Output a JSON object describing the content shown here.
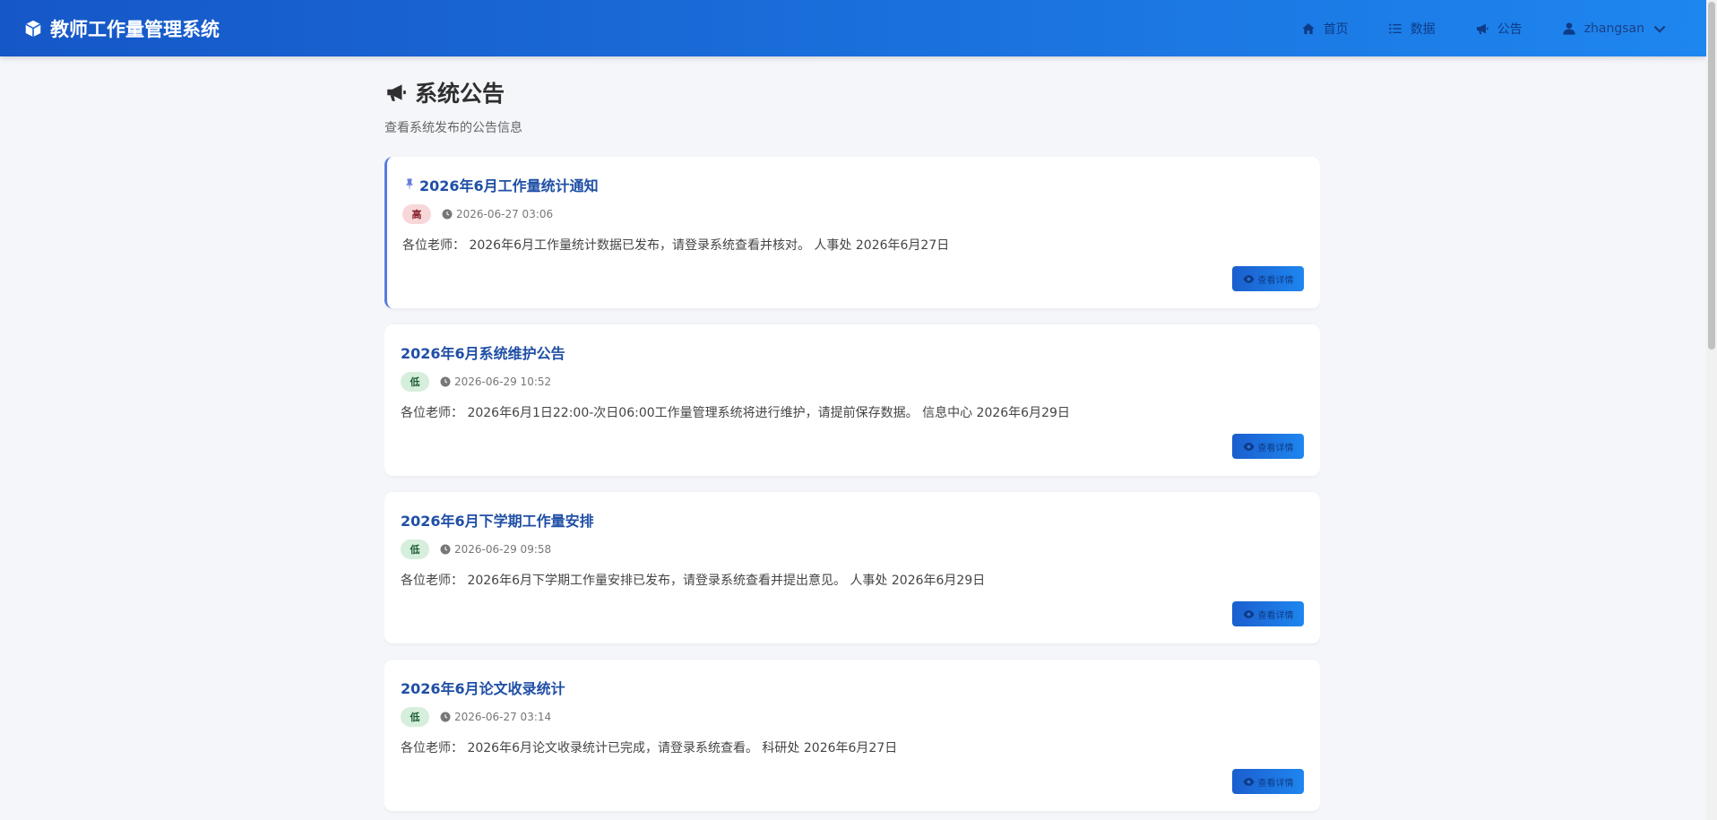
{
  "app": {
    "title": "教师工作量管理系统",
    "brand_icon": "cube-icon"
  },
  "nav": {
    "items": [
      {
        "label": "首页",
        "icon": "home-icon"
      },
      {
        "label": "数据",
        "icon": "list-icon"
      },
      {
        "label": "公告",
        "icon": "megaphone-icon"
      }
    ],
    "user": {
      "name": "zhangsan",
      "icon": "user-icon"
    }
  },
  "page": {
    "title": "系统公告",
    "subtitle": "查看系统发布的公告信息"
  },
  "announcements": [
    {
      "title": "2026年6月工作量统计通知",
      "pinned": true,
      "priority": "高",
      "time": "2026-06-27 03:06",
      "content": "各位老师： 2026年6月工作量统计数据已发布，请登录系统查看并核对。 人事处 2026年6月27日",
      "button": "查看详情"
    },
    {
      "title": "2026年6月系统维护公告",
      "pinned": false,
      "priority": "低",
      "time": "2026-06-29 10:52",
      "content": "各位老师： 2026年6月1日22:00-次日06:00工作量管理系统将进行维护，请提前保存数据。 信息中心 2026年6月29日",
      "button": "查看详情"
    },
    {
      "title": "2026年6月下学期工作量安排",
      "pinned": false,
      "priority": "低",
      "time": "2026-06-29 09:58",
      "content": "各位老师： 2026年6月下学期工作量安排已发布，请登录系统查看并提出意见。 人事处 2026年6月29日",
      "button": "查看详情"
    },
    {
      "title": "2026年6月论文收录统计",
      "pinned": false,
      "priority": "低",
      "time": "2026-06-27 03:14",
      "content": "各位老师： 2026年6月论文收录统计已完成，请登录系统查看。 科研处 2026年6月27日",
      "button": "查看详情"
    }
  ],
  "colors": {
    "nav_gradient_start": "#1657c7",
    "nav_gradient_end": "#1e86ef",
    "title_blue": "#1f4fa6",
    "high_badge_bg": "#f8d7da",
    "low_badge_bg": "#d6eedc"
  }
}
